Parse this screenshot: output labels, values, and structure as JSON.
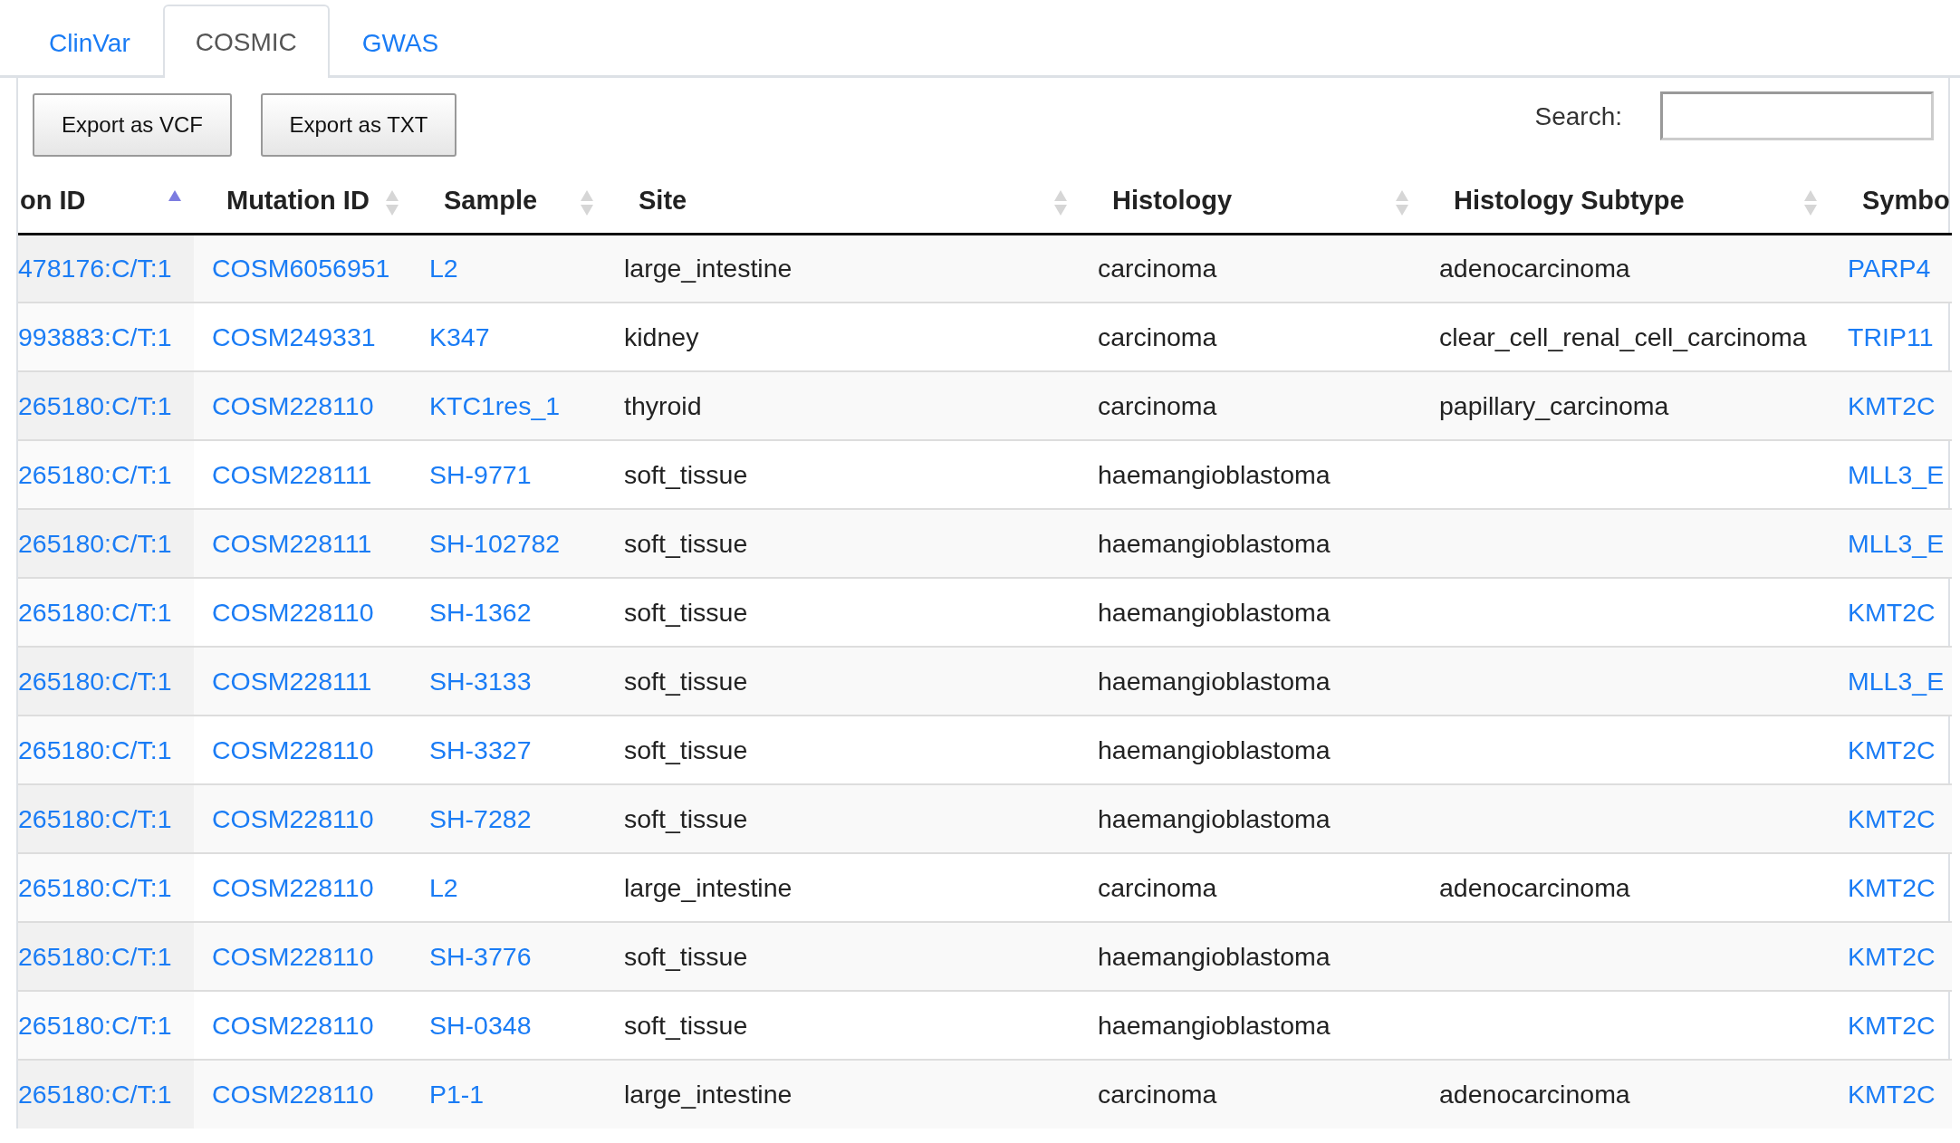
{
  "tabs": [
    {
      "label": "ClinVar",
      "selected": false
    },
    {
      "label": "COSMIC",
      "selected": true
    },
    {
      "label": "GWAS",
      "selected": false
    }
  ],
  "buttons": [
    "Export as VCF",
    "Export as TXT"
  ],
  "search": {
    "label": "Search:"
  },
  "table": {
    "columns": [
      {
        "label": "on ID",
        "kind": "link",
        "sorted": true
      },
      {
        "label": "Mutation ID",
        "kind": "link",
        "sorted": false
      },
      {
        "label": "Sample",
        "kind": "link",
        "sorted": false
      },
      {
        "label": "Site",
        "kind": "text",
        "sorted": false
      },
      {
        "label": "Histology",
        "kind": "text",
        "sorted": false
      },
      {
        "label": "Histology Subtype",
        "kind": "text",
        "sorted": false
      },
      {
        "label": "Symbo",
        "kind": "link"
      }
    ],
    "rows": [
      {
        "variant": "478176:C/T:1",
        "mutation_id": "COSM6056951",
        "sample": "L2",
        "site": "large_intestine",
        "histology": "carcinoma",
        "histology_subtype": "adenocarcinoma",
        "symbol": "PARP4"
      },
      {
        "variant": "993883:C/T:1",
        "mutation_id": "COSM249331",
        "sample": "K347",
        "site": "kidney",
        "histology": "carcinoma",
        "histology_subtype": "clear_cell_renal_cell_carcinoma",
        "symbol": "TRIP11"
      },
      {
        "variant": "265180:C/T:1",
        "mutation_id": "COSM228110",
        "sample": "KTC1res_1",
        "site": "thyroid",
        "histology": "carcinoma",
        "histology_subtype": "papillary_carcinoma",
        "symbol": "KMT2C"
      },
      {
        "variant": "265180:C/T:1",
        "mutation_id": "COSM228111",
        "sample": "SH-9771",
        "site": "soft_tissue",
        "histology": "haemangioblastoma",
        "symbol": "MLL3_E"
      },
      {
        "variant": "265180:C/T:1",
        "mutation_id": "COSM228111",
        "sample": "SH-102782",
        "site": "soft_tissue",
        "histology": "haemangioblastoma",
        "symbol": "MLL3_E"
      },
      {
        "variant": "265180:C/T:1",
        "mutation_id": "COSM228110",
        "sample": "SH-1362",
        "site": "soft_tissue",
        "histology": "haemangioblastoma",
        "symbol": "KMT2C"
      },
      {
        "variant": "265180:C/T:1",
        "mutation_id": "COSM228111",
        "sample": "SH-3133",
        "site": "soft_tissue",
        "histology": "haemangioblastoma",
        "symbol": "MLL3_E"
      },
      {
        "variant": "265180:C/T:1",
        "mutation_id": "COSM228110",
        "sample": "SH-3327",
        "site": "soft_tissue",
        "histology": "haemangioblastoma",
        "symbol": "KMT2C"
      },
      {
        "variant": "265180:C/T:1",
        "mutation_id": "COSM228110",
        "sample": "SH-7282",
        "site": "soft_tissue",
        "histology": "haemangioblastoma",
        "symbol": "KMT2C"
      },
      {
        "variant": "265180:C/T:1",
        "mutation_id": "COSM228110",
        "sample": "L2",
        "site": "large_intestine",
        "histology": "carcinoma",
        "histology_subtype": "adenocarcinoma",
        "symbol": "KMT2C"
      },
      {
        "variant": "265180:C/T:1",
        "mutation_id": "COSM228110",
        "sample": "SH-3776",
        "site": "soft_tissue",
        "histology": "haemangioblastoma",
        "symbol": "KMT2C"
      },
      {
        "variant": "265180:C/T:1",
        "mutation_id": "COSM228110",
        "sample": "SH-0348",
        "site": "soft_tissue",
        "histology": "haemangioblastoma",
        "symbol": "KMT2C"
      },
      {
        "variant": "265180:C/T:1",
        "mutation_id": "COSM228110",
        "sample": "P1-1",
        "site": "large_intestine",
        "histology": "carcinoma",
        "histology_subtype": "adenocarcinoma",
        "symbol": "KMT2C"
      }
    ]
  }
}
